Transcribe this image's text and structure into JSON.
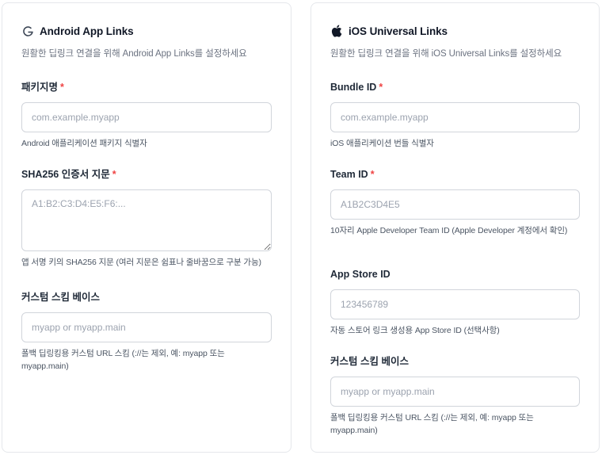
{
  "android": {
    "title": "Android App Links",
    "icon": "google-g-icon",
    "description": "원활한 딥링크 연결을 위해 Android App Links를 설정하세요",
    "package": {
      "label": "패키지명",
      "required": "*",
      "placeholder": "com.example.myapp",
      "value": "",
      "help": "Android 애플리케이션 패키지 식별자"
    },
    "sha256": {
      "label": "SHA256 인증서 지문",
      "required": "*",
      "placeholder": "A1:B2:C3:D4:E5:F6:...",
      "value": "",
      "help": "앱 서명 키의 SHA256 지문 (여러 지문은 쉼표나 줄바꿈으로 구분 가능)"
    },
    "scheme": {
      "label": "커스텀 스킴 베이스",
      "placeholder": "myapp or myapp.main",
      "value": "",
      "help": "폴백 딥링킹용 커스텀 URL 스킴 (://는 제외, 예: myapp 또는 myapp.main)"
    }
  },
  "ios": {
    "title": "iOS Universal Links",
    "icon": "apple-icon",
    "description": "원활한 딥링크 연결을 위해 iOS Universal Links를 설정하세요",
    "bundle": {
      "label": "Bundle ID",
      "required": "*",
      "placeholder": "com.example.myapp",
      "value": "",
      "help": "iOS 애플리케이션 번들 식별자"
    },
    "team": {
      "label": "Team ID",
      "required": "*",
      "placeholder": "A1B2C3D4E5",
      "value": "",
      "help": "10자리 Apple Developer Team ID (Apple Developer 계정에서 확인)"
    },
    "appstore": {
      "label": "App Store ID",
      "placeholder": "123456789",
      "value": "",
      "help": "자동 스토어 링크 생성용 App Store ID (선택사항)"
    },
    "scheme": {
      "label": "커스텀 스킴 베이스",
      "placeholder": "myapp or myapp.main",
      "value": "",
      "help": "폴백 딥링킹용 커스텀 URL 스킴 (://는 제외, 예: myapp 또는 myapp.main)"
    }
  },
  "colors": {
    "required": "#ef4444",
    "border": "#d1d5db",
    "placeholder": "#9ca3af"
  }
}
